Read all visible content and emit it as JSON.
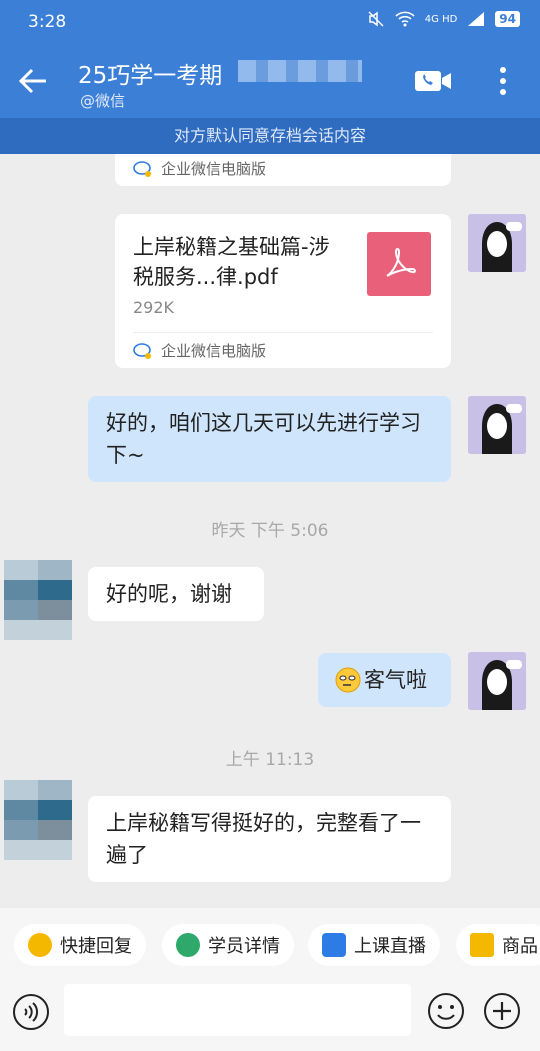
{
  "status_bar": {
    "time": "3:28",
    "network": "4G HD",
    "battery": "94"
  },
  "header": {
    "title": "25巧学一考期",
    "subtitle": "@微信"
  },
  "notice": "对方默认同意存档会话内容",
  "messages": {
    "card1_footer": "企业微信电脑版",
    "file": {
      "name": "上岸秘籍之基础篇-涉税服务...律.pdf",
      "size": "292K",
      "footer": "企业微信电脑版"
    },
    "me1": "好的，咱们这几天可以先进行学习下~",
    "ts1": "昨天  下午 5:06",
    "other1": "好的呢，谢谢",
    "me2": "客气啦",
    "ts2": "上午 11:13",
    "other2": "上岸秘籍写得挺好的，完整看了一遍了"
  },
  "quick_actions": [
    {
      "label": "快捷回复",
      "color": "#f5b800"
    },
    {
      "label": "学员详情",
      "color": "#2fa86b"
    },
    {
      "label": "上课直播",
      "color": "#2d7be5"
    },
    {
      "label": "商品",
      "color": "#f5b800"
    }
  ],
  "input": {
    "placeholder": ""
  },
  "colors": {
    "header": "#3c7fd6",
    "my_bubble": "#cfe5fb",
    "pdf": "#e9607a"
  }
}
